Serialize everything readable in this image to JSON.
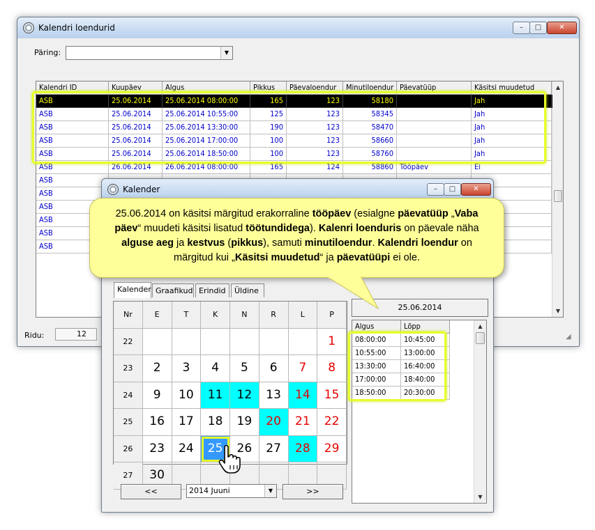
{
  "main_window": {
    "title": "Kalendri loendurid",
    "controls": {
      "minimize": "–",
      "maximize": "□",
      "close": "✕"
    },
    "query_label": "Päring:",
    "query_value": "",
    "rows_label": "Ridu:",
    "rows_count": "12"
  },
  "table": {
    "columns": [
      "Kalendri ID",
      "Kuupäev",
      "Algus",
      "Pikkus",
      "Päevaloendur",
      "Minutiloendur",
      "Päevatüüp",
      "Käsitsi muudetud"
    ],
    "rows": [
      [
        "ASB",
        "25.06.2014",
        "25.06.2014 08:00:00",
        "165",
        "123",
        "58180",
        "",
        "Jah"
      ],
      [
        "ASB",
        "25.06.2014",
        "25.06.2014 10:55:00",
        "125",
        "123",
        "58345",
        "",
        "Jah"
      ],
      [
        "ASB",
        "25.06.2014",
        "25.06.2014 13:30:00",
        "190",
        "123",
        "58470",
        "",
        "Jah"
      ],
      [
        "ASB",
        "25.06.2014",
        "25.06.2014 17:00:00",
        "100",
        "123",
        "58660",
        "",
        "Jah"
      ],
      [
        "ASB",
        "25.06.2014",
        "25.06.2014 18:50:00",
        "100",
        "123",
        "58760",
        "",
        "Jah"
      ],
      [
        "ASB",
        "26.06.2014",
        "26.06.2014 08:00:00",
        "165",
        "124",
        "58860",
        "Tööpäev",
        "Ei"
      ],
      [
        "ASB",
        "",
        "",
        "",
        "",
        "",
        "",
        ""
      ],
      [
        "ASB",
        "",
        "",
        "",
        "",
        "",
        "",
        ""
      ],
      [
        "ASB",
        "",
        "",
        "",
        "",
        "",
        "",
        ""
      ],
      [
        "ASB",
        "",
        "",
        "",
        "",
        "",
        "",
        ""
      ],
      [
        "ASB",
        "",
        "",
        "",
        "",
        "",
        "",
        ""
      ],
      [
        "ASB",
        "",
        "",
        "",
        "",
        "",
        "",
        ""
      ]
    ]
  },
  "calendar_window": {
    "title": "Kalender",
    "controls": {
      "minimize": "–",
      "maximize": "□",
      "close": "✕"
    },
    "tabs": [
      "Kalender",
      "Graafikud",
      "Erindid",
      "Üldine"
    ],
    "weekday_headers": [
      "Nr",
      "E",
      "T",
      "K",
      "N",
      "R",
      "L",
      "P"
    ],
    "weeks": [
      {
        "nr": "22",
        "days": [
          "",
          "",
          "",
          "",
          "",
          "",
          "1"
        ]
      },
      {
        "nr": "23",
        "days": [
          "2",
          "3",
          "4",
          "5",
          "6",
          "7",
          "8"
        ]
      },
      {
        "nr": "24",
        "days": [
          "9",
          "10",
          "11",
          "12",
          "13",
          "14",
          "15"
        ]
      },
      {
        "nr": "25",
        "days": [
          "16",
          "17",
          "18",
          "19",
          "20",
          "21",
          "22"
        ]
      },
      {
        "nr": "26",
        "days": [
          "23",
          "24",
          "25",
          "26",
          "27",
          "28",
          "29"
        ]
      },
      {
        "nr": "27",
        "days": [
          "30",
          "",
          "",
          "",
          "",
          "",
          ""
        ]
      }
    ],
    "prev_label": "<<",
    "next_label": ">>",
    "month_value": "2014 Juuni",
    "selected_date": "25.06.2014",
    "intervals_headers": [
      "Algus",
      "Lõpp"
    ],
    "intervals": [
      [
        "08:00:00",
        "10:45:00"
      ],
      [
        "10:55:00",
        "13:00:00"
      ],
      [
        "13:30:00",
        "16:40:00"
      ],
      [
        "17:00:00",
        "18:40:00"
      ],
      [
        "18:50:00",
        "20:30:00"
      ]
    ]
  },
  "callout_parts": [
    {
      "t": "25.06.2014 on käsitsi märgitud erakorraline ",
      "b": false
    },
    {
      "t": "tööpäev",
      "b": true
    },
    {
      "t": " (esialgne ",
      "b": false
    },
    {
      "t": "päevatüüp",
      "b": true
    },
    {
      "t": " „",
      "b": false
    },
    {
      "t": "Vaba päev",
      "b": true
    },
    {
      "t": "“ muudeti käsitsi lisatud ",
      "b": false
    },
    {
      "t": "töötundidega",
      "b": true
    },
    {
      "t": "). ",
      "b": false
    },
    {
      "t": "Kalenri loenduris",
      "b": true
    },
    {
      "t": " on päevale näha ",
      "b": false
    },
    {
      "t": "alguse aeg",
      "b": true
    },
    {
      "t": " ja ",
      "b": false
    },
    {
      "t": "kestvus",
      "b": true
    },
    {
      "t": " (",
      "b": false
    },
    {
      "t": "pikkus",
      "b": true
    },
    {
      "t": "), samuti ",
      "b": false
    },
    {
      "t": "minutiloendur",
      "b": true
    },
    {
      "t": ".  ",
      "b": false
    },
    {
      "t": "Kalendri loendur",
      "b": true
    },
    {
      "t": " on märgitud kui „",
      "b": false
    },
    {
      "t": "Käsitsi muudetud",
      "b": true
    },
    {
      "t": "“ ja ",
      "b": false
    },
    {
      "t": "päevatüüpi",
      "b": true
    },
    {
      "t": " ei ole.",
      "b": false
    }
  ],
  "colors": {
    "highlight": "#e7ff2a",
    "callout": "#ffff99",
    "weekend": "#e60000",
    "cyan_day": "#00ffff",
    "selected_day": "#3399ff"
  },
  "icons": [
    "calendar-window-icon",
    "hand-pointer-icon"
  ]
}
